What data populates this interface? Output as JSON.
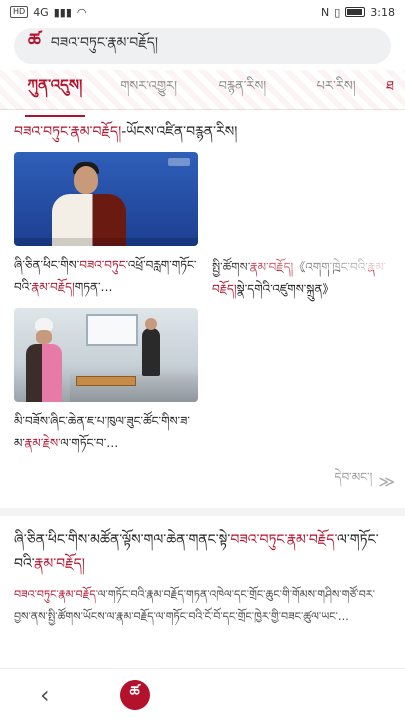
{
  "status_bar": {
    "network": "HD",
    "signal": "4G",
    "time": "3:18"
  },
  "search": {
    "logo": "ཚ",
    "text": "བཟའ་བཏུང་རྣམ་བརྗོད།"
  },
  "tabs": [
    {
      "label": "ཀུན་འདུས།",
      "active": true
    },
    {
      "label": "གསར་འགྱུར།",
      "active": false
    },
    {
      "label": "བརྙན་རིས།",
      "active": false
    },
    {
      "label": "པར་རིས།",
      "active": false
    },
    {
      "label": "ཐ",
      "active": false
    }
  ],
  "section": {
    "title_red": "བཟའ་བཏུང་རྣམ་བརྗོད།",
    "title_rest": "-ཡོངས་འཛིན་བརྙན་རིས།"
  },
  "cards": [
    {
      "text_a": "ཞི་ཅིན་ཕིང་གིས་",
      "text_red": "བཟའ་བཏུང་",
      "text_b": "འཕྲོ་བརླག་གཏོང་བའི་",
      "text_red2": "རྣམ་བརྗོད།",
      "text_c": "གཏན་…"
    },
    {
      "text_a": "སྤྱི་ཚོགས་",
      "text_red": "རྣམ་བརྗོད།",
      "text_b": "《འགག་ཁྲེང་བའི་",
      "text_red2": "རྣམ་བརྗོད།",
      "text_c": "སྣེ་དགེའི་འཛུགས་སྐྲུན》"
    },
    {
      "text_a": "མི་བཟོས་ཞིང་ཆེན་ཇ་པ་ཁུལ་ཟུང་ཚོང་",
      "text_red": "",
      "text_b": "གིས་ཟ་མ་",
      "text_red2": "རྣམ་རྗེས་",
      "text_c": "ལ་གཏོང་བ་…"
    }
  ],
  "more": {
    "label": "དེབ་མང་།",
    "arrows": "≫"
  },
  "article": {
    "headline_a": "ཞི་ཅིན་ཕིང་གིས་མཚོན་ལྟོས་གལ་ཆེན་གནང་སྟེ་",
    "headline_red": "བཟའ་བཏུང་རྣམ་བརྗོད་",
    "headline_b": "ལ་གཏོང་བའི་",
    "headline_red2": "རྣམ་བརྗོད།",
    "body_red": "བཟའ་བཏུང་རྣམ་བརྗོད་",
    "body": "ལ་གཏོང་བའི་རྣམ་བརྗོད་གཏན་འཁེལ་དང་གྲོང་ཆུང་གི་གོམས་གཤིས་གཙོ་བར་བྱས་ནས་སྤྱི་ཚོགས་ཡོངས་ལ་རྣམ་བརྗོད་ལ་གཏོང་བའི་ངོ་བོ་དང་གྲོང་ཁྱེར་གྱི་བཟང་ཚུལ་ཡང་…"
  },
  "bottom_nav": {
    "back": "‹",
    "home_logo": "ཚ"
  }
}
